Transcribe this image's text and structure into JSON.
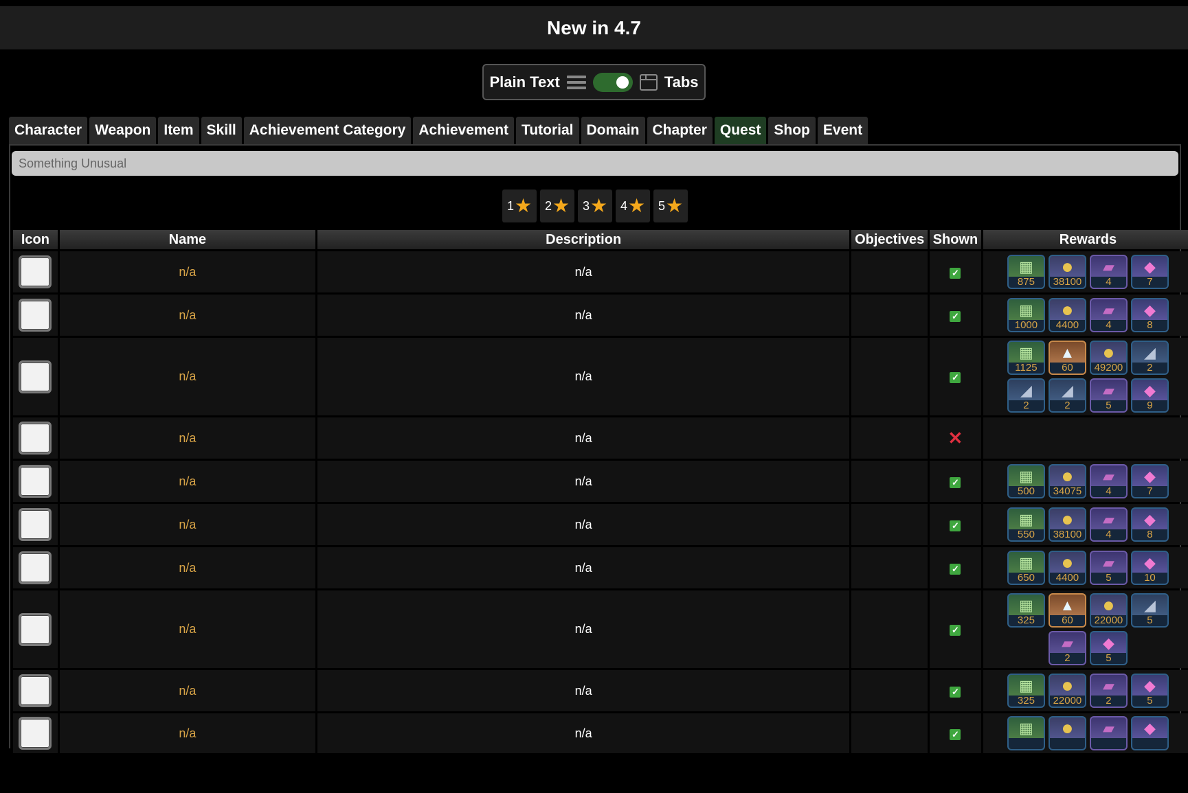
{
  "header": {
    "title": "New in 4.7"
  },
  "view_toggle": {
    "left_label": "Plain Text",
    "right_label": "Tabs"
  },
  "tabs": [
    {
      "label": "Character",
      "active": false
    },
    {
      "label": "Weapon",
      "active": false
    },
    {
      "label": "Item",
      "active": false
    },
    {
      "label": "Skill",
      "active": false
    },
    {
      "label": "Achievement Category",
      "active": false
    },
    {
      "label": "Achievement",
      "active": false
    },
    {
      "label": "Tutorial",
      "active": false
    },
    {
      "label": "Domain",
      "active": false
    },
    {
      "label": "Chapter",
      "active": false
    },
    {
      "label": "Quest",
      "active": true
    },
    {
      "label": "Shop",
      "active": false
    },
    {
      "label": "Event",
      "active": false
    }
  ],
  "search": {
    "placeholder": "Something Unusual",
    "value": ""
  },
  "star_filters": [
    "1",
    "2",
    "3",
    "4",
    "5"
  ],
  "table": {
    "columns": [
      "Icon",
      "Name",
      "Description",
      "Objectives",
      "Shown",
      "Rewards"
    ],
    "rows": [
      {
        "name": "n/a",
        "description": "n/a",
        "shown": true,
        "rewards": [
          {
            "icon": "exp-icon",
            "count": "875"
          },
          {
            "icon": "mora-icon",
            "count": "38100"
          },
          {
            "icon": "book-icon",
            "count": "4"
          },
          {
            "icon": "gem-icon",
            "count": "7"
          }
        ]
      },
      {
        "name": "n/a",
        "description": "n/a",
        "shown": true,
        "rewards": [
          {
            "icon": "exp-icon",
            "count": "1000"
          },
          {
            "icon": "mora-icon",
            "count": "4400"
          },
          {
            "icon": "book-icon",
            "count": "4"
          },
          {
            "icon": "gem-icon",
            "count": "8"
          }
        ]
      },
      {
        "name": "n/a",
        "description": "n/a",
        "shown": true,
        "rewards": [
          {
            "icon": "exp-icon",
            "count": "1125"
          },
          {
            "icon": "primogem-icon",
            "count": "60"
          },
          {
            "icon": "mora-icon",
            "count": "49200"
          },
          {
            "icon": "ore-icon",
            "count": "2"
          },
          {
            "icon": "ore-icon",
            "count": "2"
          },
          {
            "icon": "ore-icon",
            "count": "2"
          },
          {
            "icon": "book-icon",
            "count": "5"
          },
          {
            "icon": "gem-icon",
            "count": "9"
          }
        ]
      },
      {
        "name": "n/a",
        "description": "n/a",
        "shown": false,
        "rewards": []
      },
      {
        "name": "n/a",
        "description": "n/a",
        "shown": true,
        "rewards": [
          {
            "icon": "exp-icon",
            "count": "500"
          },
          {
            "icon": "mora-icon",
            "count": "34075"
          },
          {
            "icon": "book-icon",
            "count": "4"
          },
          {
            "icon": "gem-icon",
            "count": "7"
          }
        ]
      },
      {
        "name": "n/a",
        "description": "n/a",
        "shown": true,
        "rewards": [
          {
            "icon": "exp-icon",
            "count": "550"
          },
          {
            "icon": "mora-icon",
            "count": "38100"
          },
          {
            "icon": "book-icon",
            "count": "4"
          },
          {
            "icon": "gem-icon",
            "count": "8"
          }
        ]
      },
      {
        "name": "n/a",
        "description": "n/a",
        "shown": true,
        "rewards": [
          {
            "icon": "exp-icon",
            "count": "650"
          },
          {
            "icon": "mora-icon",
            "count": "4400"
          },
          {
            "icon": "book-icon",
            "count": "5"
          },
          {
            "icon": "gem-icon",
            "count": "10"
          }
        ]
      },
      {
        "name": "n/a",
        "description": "n/a",
        "shown": true,
        "rewards": [
          {
            "icon": "exp-icon",
            "count": "325"
          },
          {
            "icon": "primogem-icon",
            "count": "60"
          },
          {
            "icon": "mora-icon",
            "count": "22000"
          },
          {
            "icon": "ore-icon",
            "count": "5"
          },
          {
            "icon": "book-icon",
            "count": "2"
          },
          {
            "icon": "gem-icon",
            "count": "5"
          }
        ]
      },
      {
        "name": "n/a",
        "description": "n/a",
        "shown": true,
        "rewards": [
          {
            "icon": "exp-icon",
            "count": "325"
          },
          {
            "icon": "mora-icon",
            "count": "22000"
          },
          {
            "icon": "book-icon",
            "count": "2"
          },
          {
            "icon": "gem-icon",
            "count": "5"
          }
        ]
      },
      {
        "name": "n/a",
        "description": "n/a",
        "shown": true,
        "rewards": [
          {
            "icon": "exp-icon",
            "count": ""
          },
          {
            "icon": "mora-icon",
            "count": ""
          },
          {
            "icon": "book-icon",
            "count": ""
          },
          {
            "icon": "gem-icon",
            "count": ""
          }
        ]
      }
    ]
  },
  "colors": {
    "accent_tab": "#1f3d23",
    "name_text": "#d8a447",
    "check": "#3fa73f",
    "cross": "#e03040"
  }
}
